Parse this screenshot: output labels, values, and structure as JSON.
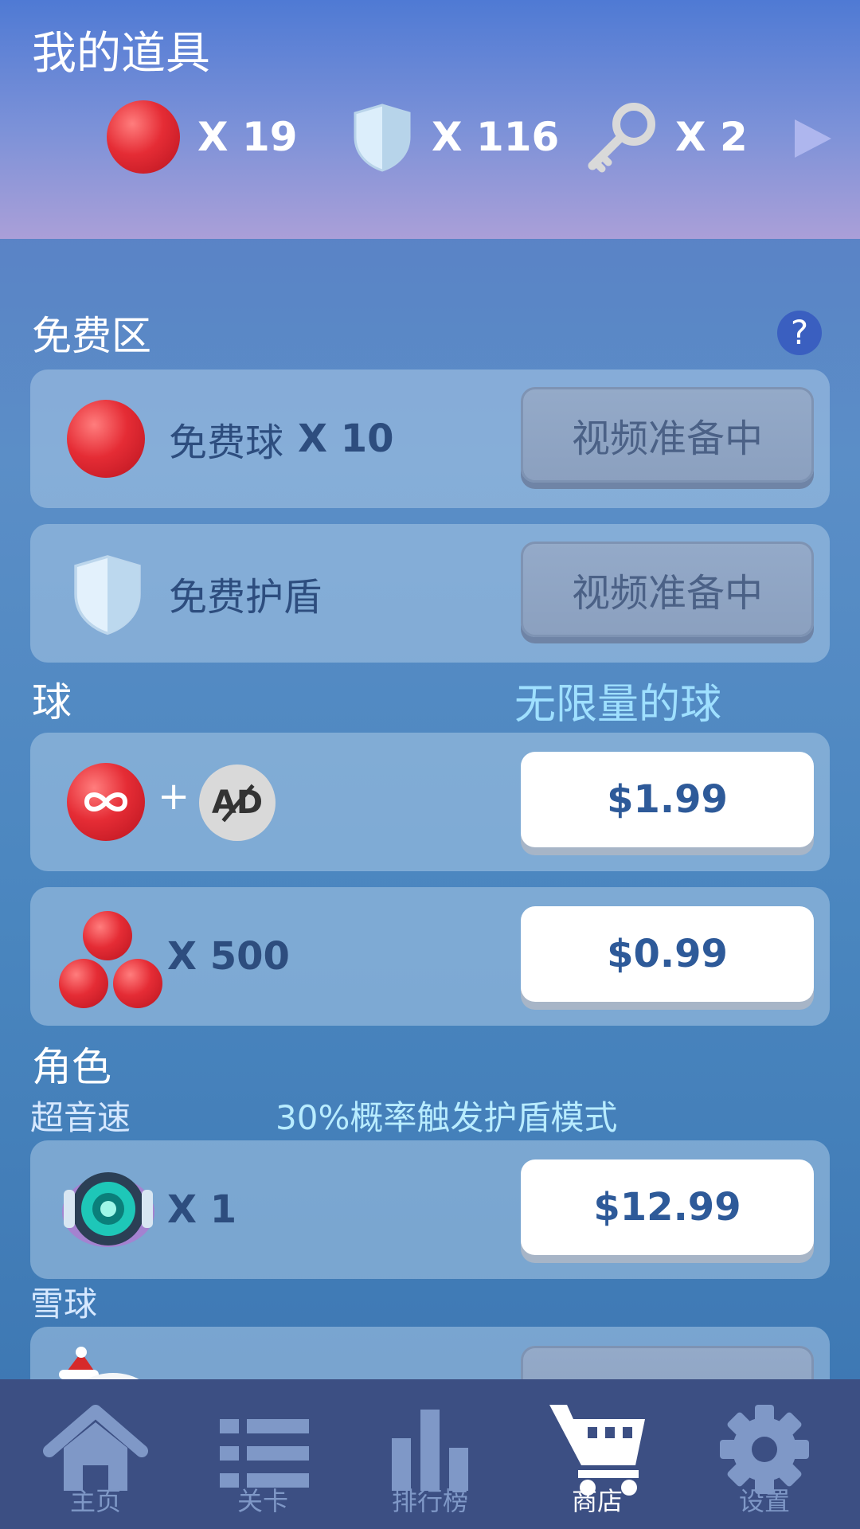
{
  "header": {
    "title": "我的道具",
    "inventory": [
      {
        "icon": "red-ball-icon",
        "count": "X 19"
      },
      {
        "icon": "shield-icon",
        "count": "X 116"
      },
      {
        "icon": "key-icon",
        "count": "X 2"
      }
    ],
    "more_icon": "arrow-right-icon"
  },
  "free_zone": {
    "label": "免费区",
    "help_label": "?",
    "items": [
      {
        "icon": "red-ball-icon",
        "name": "免费球",
        "qty": "X 10",
        "button": "视频准备中"
      },
      {
        "icon": "shield-icon",
        "name": "免费护盾",
        "qty": "",
        "button": "视频准备中"
      }
    ]
  },
  "balls": {
    "label": "球",
    "sub_label": "无限量的球",
    "items": [
      {
        "icon": "infinity-ball-icon",
        "plus": "+",
        "ad_text": "AD",
        "price": "$1.99"
      },
      {
        "icon": "ball-stack-icon",
        "qty": "X 500",
        "price": "$0.99"
      }
    ]
  },
  "characters": {
    "label": "角色",
    "items": [
      {
        "name": "超音速",
        "desc": "30%概率触发护盾模式",
        "icon": "robot-character-icon",
        "qty": "X 1",
        "price": "$12.99"
      },
      {
        "name": "雪球",
        "icon": "snowman-character-icon"
      }
    ]
  },
  "nav": [
    {
      "icon": "home-icon",
      "label": "主页",
      "active": false
    },
    {
      "icon": "list-icon",
      "label": "关卡",
      "active": false
    },
    {
      "icon": "leaderboard-icon",
      "label": "排行榜",
      "active": false
    },
    {
      "icon": "cart-icon",
      "label": "商店",
      "active": true
    },
    {
      "icon": "gear-icon",
      "label": "设置",
      "active": false
    }
  ],
  "colors": {
    "accent_text": "#2e5a99",
    "nav_bg": "#3c4f83",
    "highlight": "#9fe0ff"
  }
}
